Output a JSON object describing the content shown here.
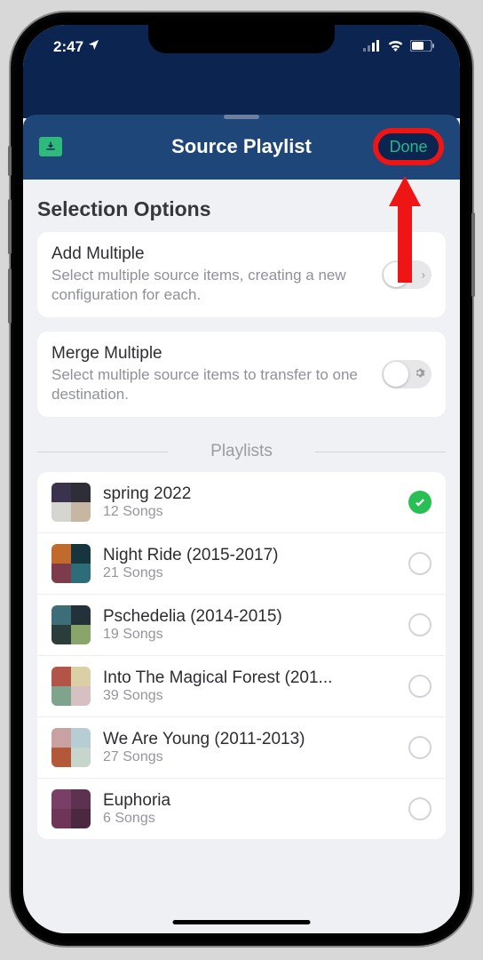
{
  "status": {
    "time": "2:47"
  },
  "header": {
    "title": "Source Playlist",
    "done_label": "Done"
  },
  "selection": {
    "heading": "Selection Options",
    "options": [
      {
        "title": "Add Multiple",
        "desc": "Select multiple source items, creating a new configuration for each."
      },
      {
        "title": "Merge Multiple",
        "desc": "Select multiple source items to transfer to one destination."
      }
    ]
  },
  "playlists_heading": "Playlists",
  "playlists": [
    {
      "name": "spring 2022",
      "count": "12 Songs",
      "selected": true,
      "art": [
        "#3b334e",
        "#2e2e38",
        "#d6d6d0",
        "#c7b7a2"
      ]
    },
    {
      "name": "Night Ride (2015-2017)",
      "count": "21 Songs",
      "selected": false,
      "art": [
        "#c2692e",
        "#16353e",
        "#7d3b4c",
        "#2c6d77"
      ]
    },
    {
      "name": "Pschedelia (2014-2015)",
      "count": "19 Songs",
      "selected": false,
      "art": [
        "#3c6d78",
        "#23313a",
        "#2a3d3a",
        "#8aa56a"
      ]
    },
    {
      "name": "Into The Magical Forest (201...",
      "count": "39 Songs",
      "selected": false,
      "art": [
        "#b45348",
        "#dbcfa5",
        "#7ea48e",
        "#d7c0c2"
      ]
    },
    {
      "name": "We Are Young (2011-2013)",
      "count": "27 Songs",
      "selected": false,
      "art": [
        "#c9a1a3",
        "#b6cdd4",
        "#b35838",
        "#c7d6cc"
      ]
    },
    {
      "name": "Euphoria",
      "count": "6 Songs",
      "selected": false,
      "art": [
        "#7a3f66",
        "#5d3150",
        "#6e3558",
        "#4c2840"
      ]
    }
  ]
}
